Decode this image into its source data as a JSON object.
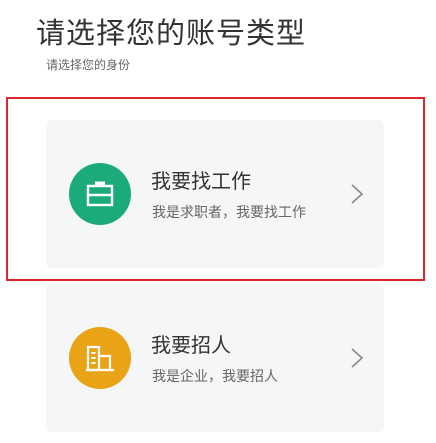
{
  "header": {
    "title": "请选择您的账号类型",
    "subtitle": "请选择您的身份"
  },
  "options": [
    {
      "title": "我要找工作",
      "description": "我是求职者，我要找工作",
      "icon": "briefcase-icon",
      "icon_color": "#1bab7a"
    },
    {
      "title": "我要招人",
      "description": "我是企业，我要招人",
      "icon": "company-icon",
      "icon_color": "#e9a316"
    }
  ],
  "colors": {
    "highlight": "#e0262d",
    "card_background": "#f5f6f7",
    "chevron": "#8a8a8a"
  }
}
